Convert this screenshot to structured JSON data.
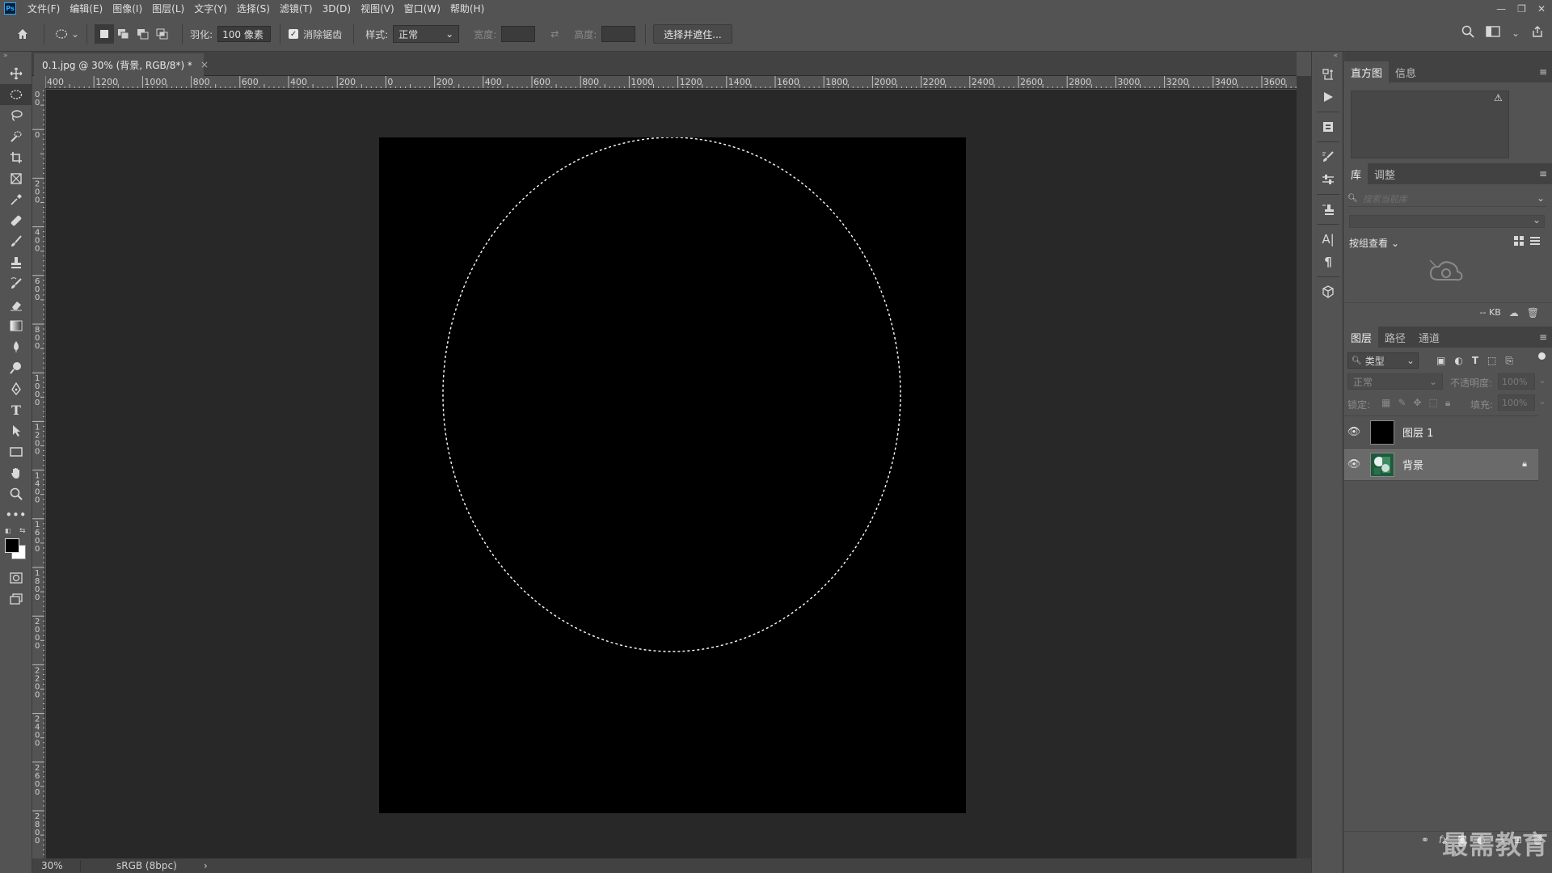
{
  "app": {
    "logo": "Ps"
  },
  "menu": [
    "文件(F)",
    "编辑(E)",
    "图像(I)",
    "图层(L)",
    "文字(Y)",
    "选择(S)",
    "滤镜(T)",
    "3D(D)",
    "视图(V)",
    "窗口(W)",
    "帮助(H)"
  ],
  "options": {
    "feather_label": "羽化:",
    "feather_value": "100 像素",
    "antialias_label": "消除锯齿",
    "antialias_checked": true,
    "style_label": "样式:",
    "style_value": "正常",
    "width_label": "宽度:",
    "height_label": "高度:",
    "select_mask_button": "选择并遮住..."
  },
  "document": {
    "tab_title": "0.1.jpg @ 30% (背景, RGB/8*) *",
    "zoom": "30%",
    "color_profile": "sRGB (8bpc)"
  },
  "ruler": {
    "top_labels": [
      "400",
      "1200",
      "1000",
      "800",
      "600",
      "400",
      "200",
      "0",
      "200",
      "400",
      "600",
      "800",
      "1000",
      "1200",
      "1400",
      "1600",
      "1800",
      "2000",
      "2200",
      "2400",
      "2600",
      "2800",
      "3000",
      "3200",
      "3400",
      "3600"
    ],
    "left_labels": [
      "200",
      "0",
      "200",
      "400",
      "600",
      "800",
      "1000",
      "1200",
      "1400",
      "1600",
      "1800",
      "2000",
      "2200",
      "2400",
      "2600",
      "2800"
    ]
  },
  "panels": {
    "top_tabs": [
      "直方图",
      "信息"
    ],
    "library_tabs": [
      "库",
      "调整"
    ],
    "library_search_placeholder": "搜索当前库",
    "library_view_label": "按组查看",
    "library_size": "-- KB",
    "layers_tabs": [
      "图层",
      "路径",
      "通道"
    ],
    "filter_kind": "类型",
    "blend_mode": "正常",
    "opacity_label": "不透明度:",
    "opacity_value": "100%",
    "lock_label": "锁定:",
    "fill_label": "填充:",
    "fill_value": "100%",
    "layers": [
      {
        "name": "图层 1",
        "thumb": "black",
        "selected": false,
        "locked": false
      },
      {
        "name": "背景",
        "thumb": "photo",
        "selected": true,
        "locked": true
      }
    ]
  },
  "watermark": "最需教育",
  "colors": {
    "ui_bg": "#535353",
    "canvas_bg": "#282828",
    "document_fill": "#000000",
    "selection_marquee": "#ffffff",
    "selected_layer": "#6a6a6a"
  }
}
